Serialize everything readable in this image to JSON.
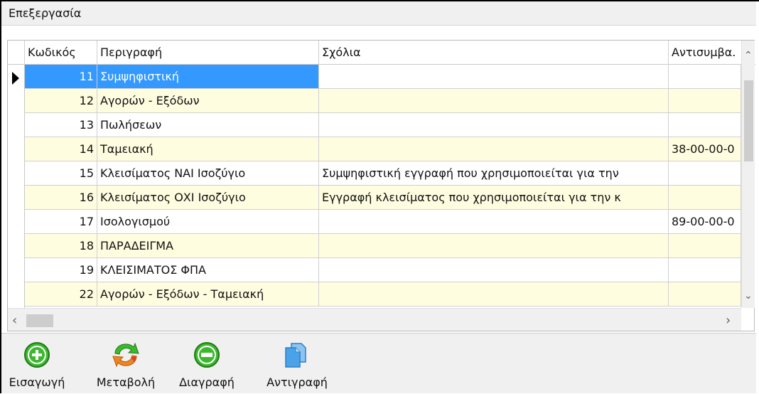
{
  "panel": {
    "title": "Επεξεργασία"
  },
  "columns": [
    "Κωδικός",
    "Περιγραφή",
    "Σχόλια",
    "Αντισυμβα."
  ],
  "rows": [
    {
      "code": "11",
      "description": "Συμψηφιστική",
      "comments": "",
      "counter": "",
      "selected": true
    },
    {
      "code": "12",
      "description": "Αγορών - Εξόδων",
      "comments": "",
      "counter": ""
    },
    {
      "code": "13",
      "description": "Πωλήσεων",
      "comments": "",
      "counter": ""
    },
    {
      "code": "14",
      "description": "Ταμειακή",
      "comments": "",
      "counter": "38-00-00-0"
    },
    {
      "code": "15",
      "description": "Κλεισίματος ΝΑΙ Ισοζύγιο",
      "comments": "Συμψηφιστική εγγραφή που χρησιμοποιείται για την",
      "counter": ""
    },
    {
      "code": "16",
      "description": "Κλεισίματος ΟΧΙ Ισοζύγιο",
      "comments": "Εγγραφή κλεισίματος που χρησιμοποιείται για την κ",
      "counter": ""
    },
    {
      "code": "17",
      "description": "Ισολογισμού",
      "comments": "",
      "counter": "89-00-00-0"
    },
    {
      "code": "18",
      "description": "ΠΑΡΑΔΕΙΓΜΑ",
      "comments": "",
      "counter": ""
    },
    {
      "code": "19",
      "description": "ΚΛΕΙΣΙΜΑΤΟΣ ΦΠΑ",
      "comments": "",
      "counter": ""
    },
    {
      "code": "22",
      "description": "Αγορών - Εξόδων - Ταμειακή",
      "comments": "",
      "counter": ""
    }
  ],
  "toolbar": {
    "insert_label": "Εισαγωγή",
    "edit_label": "Μεταβολή",
    "delete_label": "Διαγραφή",
    "copy_label": "Αντιγραφή"
  },
  "colors": {
    "selected_row": "#3399ff",
    "alt_row": "#fffde0",
    "insert_icon": "#3cb82e",
    "delete_icon": "#3cb82e",
    "edit_icon_orange": "#f0841e",
    "copy_icon": "#3a8fd8"
  },
  "icons": {
    "insert": "plus-circle-icon",
    "edit": "refresh-arrows-icon",
    "delete": "minus-circle-icon",
    "copy": "copy-pages-icon",
    "row_pointer": "row-pointer-icon"
  }
}
